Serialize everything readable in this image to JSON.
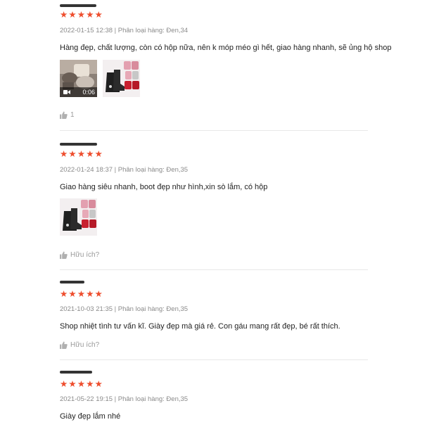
{
  "colors": {
    "star": "#ee4d2d",
    "meta": "#8a8a8a",
    "divider": "#e8e8e8"
  },
  "reviews": [
    {
      "rating": 5,
      "meta": "2022-01-15 12:38 | Phân loại hàng: Đen,34",
      "content": "Hàng đẹp, chất lượng, còn có hộp nữa, nên k móp méo gì hết, giao hàng nhanh, sẽ ủng hộ shop",
      "media": [
        {
          "kind": "video",
          "duration": "0:06",
          "icon": "video-camera-icon"
        },
        {
          "kind": "image",
          "description": "boot-product-photo"
        }
      ],
      "like_label": "1"
    },
    {
      "rating": 5,
      "meta": "2022-01-24 18:37 | Phân loại hàng: Đen,35",
      "content": "Giao hàng siêu nhanh, boot đẹp như hình,xin sò lắm, có hộp",
      "media": [
        {
          "kind": "image",
          "description": "boot-product-photo"
        }
      ],
      "like_label": "Hữu ích?"
    },
    {
      "rating": 5,
      "meta": "2021-10-03 21:35 | Phân loại hàng: Đen,35",
      "content": "Shop nhiệt tình tư vấn kĩ. Giày đẹp mà giá rẻ. Con gáu mang rất đẹp, bé rất thích.",
      "media": [],
      "like_label": "Hữu ích?"
    },
    {
      "rating": 5,
      "meta": "2021-05-22 19:15 | Phân loại hàng: Đen,35",
      "content": "Giày đẹp lắm nhé",
      "media": []
    }
  ],
  "icons": {
    "like": "thumbs-up-icon",
    "star": "star-icon"
  }
}
